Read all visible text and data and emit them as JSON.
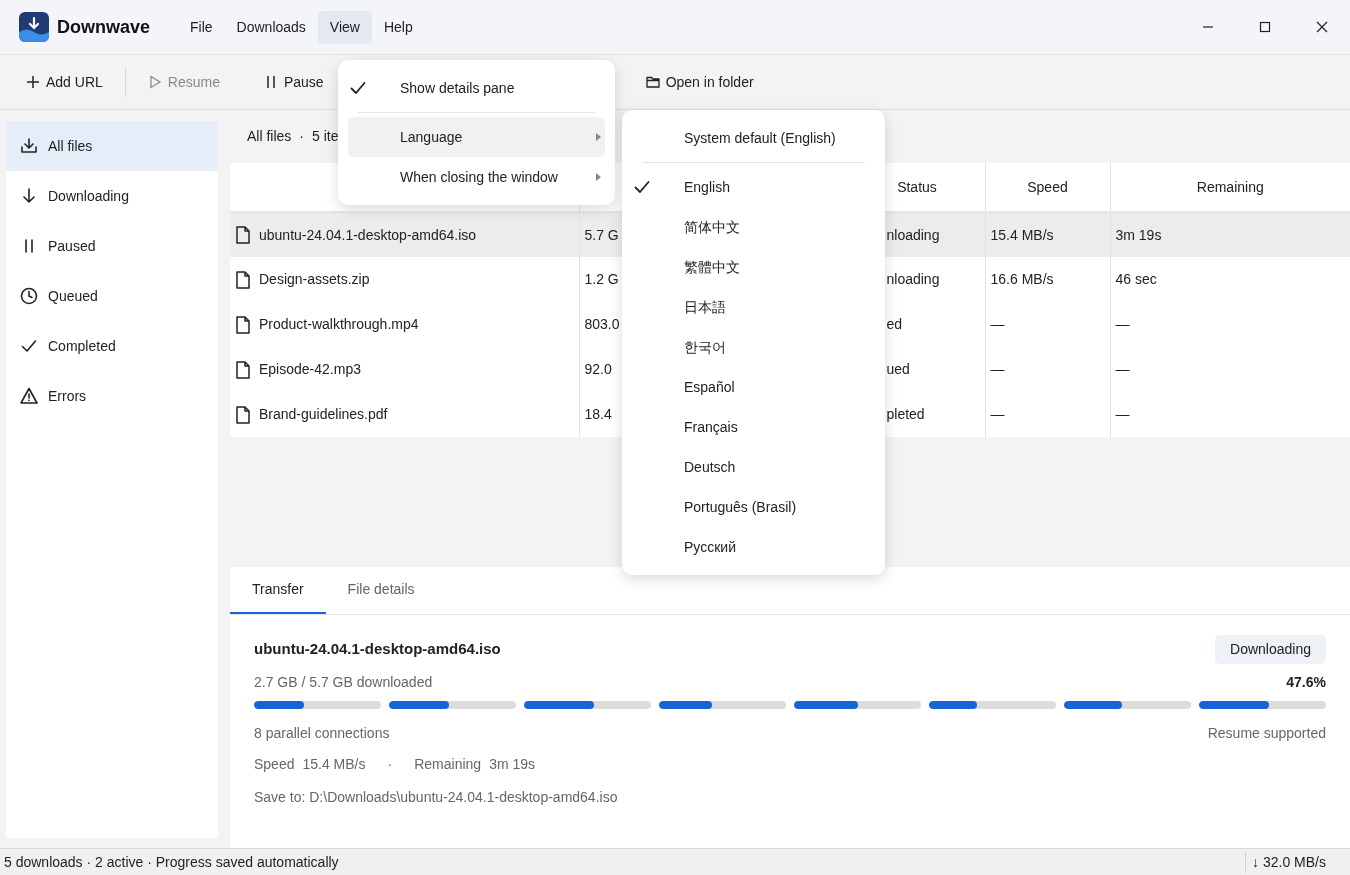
{
  "app": {
    "title": "Downwave"
  },
  "menu_bar": [
    {
      "label": "File",
      "selected": false
    },
    {
      "label": "Downloads",
      "selected": false
    },
    {
      "label": "View",
      "selected": true
    },
    {
      "label": "Help",
      "selected": false
    }
  ],
  "toolbar": [
    {
      "label": "Add URL",
      "kind": "add",
      "disabled": false
    },
    {
      "label": "Resume",
      "kind": "play",
      "disabled": true
    },
    {
      "label": "Pause",
      "kind": "pause",
      "disabled": false
    },
    {
      "label": "Open in folder",
      "kind": "folder",
      "disabled": false
    }
  ],
  "sidebar": {
    "items": [
      {
        "label": "All files",
        "kind": "all",
        "selected": true
      },
      {
        "label": "Downloading",
        "kind": "down",
        "selected": false
      },
      {
        "label": "Paused",
        "kind": "pause",
        "selected": false
      },
      {
        "label": "Queued",
        "kind": "clock",
        "selected": false
      },
      {
        "label": "Completed",
        "kind": "check",
        "selected": false
      },
      {
        "label": "Errors",
        "kind": "warn",
        "selected": false
      }
    ]
  },
  "list_header": {
    "title": "All files",
    "separator": "·",
    "count": "5 ite"
  },
  "table": {
    "columns": [
      {
        "label": "Status"
      },
      {
        "label": "Speed"
      },
      {
        "label": "Remaining"
      }
    ],
    "rows": [
      {
        "name": "ubuntu-24.04.1-desktop-amd64.iso",
        "size": "5.7 G",
        "status": "nloading",
        "speed": "15.4 MB/s",
        "remaining": "3m 19s",
        "selected": true
      },
      {
        "name": "Design-assets.zip",
        "size": "1.2 G",
        "status": "nloading",
        "speed": "16.6 MB/s",
        "remaining": "46 sec",
        "selected": false
      },
      {
        "name": "Product-walkthrough.mp4",
        "size": "803.0",
        "status": "ed",
        "speed": "—",
        "remaining": "—",
        "selected": false
      },
      {
        "name": "Episode-42.mp3",
        "size": "92.0",
        "status": "ued",
        "speed": "—",
        "remaining": "—",
        "selected": false
      },
      {
        "name": "Brand-guidelines.pdf",
        "size": "18.4",
        "status": "pleted",
        "speed": "—",
        "remaining": "—",
        "selected": false
      }
    ]
  },
  "details": {
    "tabs": [
      {
        "label": "Transfer",
        "selected": true
      },
      {
        "label": "File details",
        "selected": false
      }
    ],
    "file_name": "ubuntu-24.04.1-desktop-amd64.iso",
    "status_badge": "Downloading",
    "downloaded": "2.7 GB / 5.7 GB downloaded",
    "percent": "47.6%",
    "segments": [
      {
        "level": 0.39
      },
      {
        "level": 0.47
      },
      {
        "level": 0.55
      },
      {
        "level": 0.42
      },
      {
        "level": 0.5
      },
      {
        "level": 0.38
      },
      {
        "level": 0.46
      },
      {
        "level": 0.55
      }
    ],
    "connections": "8 parallel connections",
    "resume": "Resume supported",
    "speed_label": "Speed",
    "speed": "15.4 MB/s",
    "separator": "·",
    "remaining_label": "Remaining",
    "remaining": "3m 19s",
    "save_to": "Save to: D:\\Downloads\\ubuntu-24.04.1-desktop-amd64.iso"
  },
  "status_bar": {
    "text": "5 downloads · 2 active · Progress saved automatically",
    "rate": "↓ 32.0 MB/s"
  },
  "view_menu": {
    "items": [
      {
        "label": "Show details pane",
        "kind": "toggle",
        "checked": true
      },
      {
        "label": "Language",
        "kind": "submenu",
        "highlighted": true
      },
      {
        "label": "When closing the window",
        "kind": "submenu",
        "highlighted": false
      }
    ]
  },
  "language_menu": {
    "items": [
      {
        "label": "System default (English)",
        "kind": "default",
        "selected": false
      },
      {
        "label": "English",
        "kind": "language",
        "selected": true
      },
      {
        "label": "简体中文",
        "kind": "language",
        "selected": false
      },
      {
        "label": "繁體中文",
        "kind": "language",
        "selected": false
      },
      {
        "label": "日本語",
        "kind": "language",
        "selected": false
      },
      {
        "label": "한국어",
        "kind": "language",
        "selected": false
      },
      {
        "label": "Español",
        "kind": "language",
        "selected": false
      },
      {
        "label": "Français",
        "kind": "language",
        "selected": false
      },
      {
        "label": "Deutsch",
        "kind": "language",
        "selected": false
      },
      {
        "label": "Português (Brasil)",
        "kind": "language",
        "selected": false
      },
      {
        "label": "Русский",
        "kind": "language",
        "selected": false
      }
    ]
  }
}
